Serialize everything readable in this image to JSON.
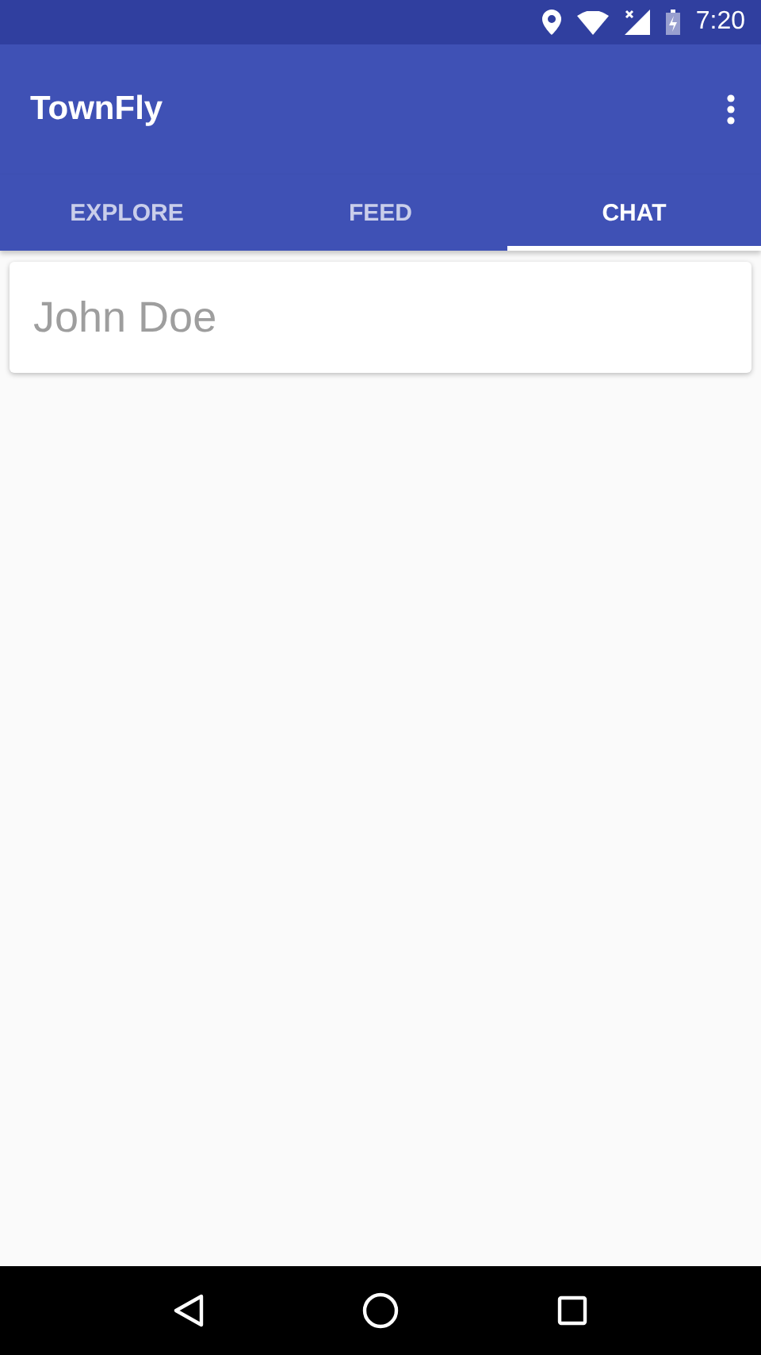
{
  "status_bar": {
    "time": "7:20"
  },
  "app_bar": {
    "title": "TownFly"
  },
  "tabs": [
    {
      "label": "EXPLORE",
      "selected": false
    },
    {
      "label": "FEED",
      "selected": false
    },
    {
      "label": "CHAT",
      "selected": true
    }
  ],
  "chats": [
    {
      "name": "John Doe"
    }
  ]
}
